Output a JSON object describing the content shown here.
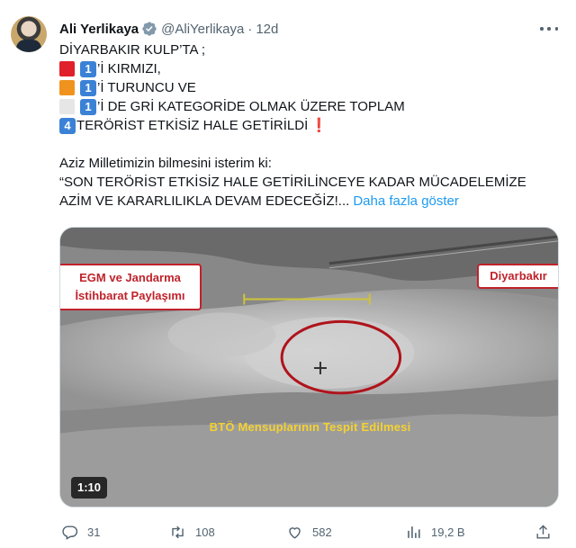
{
  "author": {
    "name": "Ali Yerlikaya",
    "handle": "@AliYerlikaya",
    "separator": "·",
    "time": "12d"
  },
  "tweet": {
    "line1": "DİYARBAKIR KULP’TA ;",
    "line2": "’İ KIRMIZI,",
    "line3": "’İ TURUNCU VE",
    "line4": "’İ DE GRİ KATEGORİDE OLMAK ÜZERE TOPLAM",
    "line5": "TERÖRİST ETKİSİZ HALE GETİRİLDİ",
    "line6": "Aziz Milletimizin bilmesini isterim ki:",
    "line7": "“SON TERÖRİST ETKİSİZ HALE GETİRİLİNCEYE KADAR MÜCADELEMİZE",
    "line8": "AZİM VE KARARLILIKLA DEVAM EDECEĞİZ!...",
    "show_more": "Daha fazla göster",
    "badge_one": "1",
    "badge_four": "4",
    "exclamation": "❗"
  },
  "colors": {
    "red_square": "#e0212b",
    "orange_square": "#f0931e",
    "gray_square": "#e6e6e6",
    "link": "#1d9bf0",
    "caption": "#f5d130"
  },
  "media": {
    "tag_left_line1": "EGM ve Jandarma",
    "tag_left_line2": "İstihbarat Paylaşımı",
    "tag_right": "Diyarbakır",
    "caption": "BTÖ Mensuplarının  Tespit Edilmesi",
    "duration": "1:10"
  },
  "actions": {
    "replies": "31",
    "retweets": "108",
    "likes": "582",
    "views": "19,2 B"
  },
  "icons": [
    "verified-badge-icon",
    "more-icon",
    "reply-icon",
    "retweet-icon",
    "like-icon",
    "views-icon",
    "share-icon"
  ]
}
